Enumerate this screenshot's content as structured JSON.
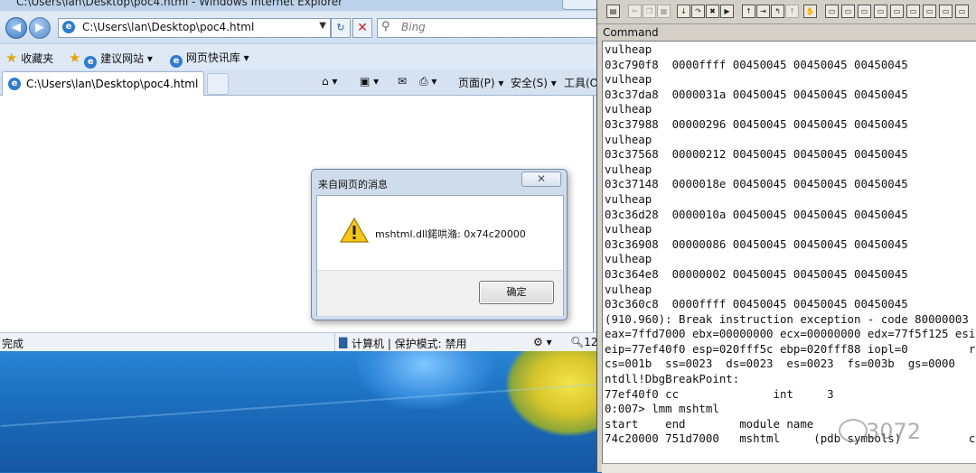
{
  "ie": {
    "title": "C:\\Users\\lan\\Desktop\\poc4.html - Windows Internet Explorer",
    "address": "C:\\Users\\lan\\Desktop\\poc4.html",
    "search_placeholder": "Bing",
    "favorites_label": "收藏夹",
    "fav_items": [
      "建议网站 ▾",
      "网页快讯库 ▾"
    ],
    "tab_title": "C:\\Users\\lan\\Desktop\\poc4.html",
    "commands": [
      "页面(P) ▾",
      "安全(S) ▾",
      "工具(O)"
    ],
    "status_left": "完成",
    "status_zone": "计算机 | 保护模式: 禁用",
    "zoom": "12"
  },
  "dialog": {
    "title": "来自网页的消息",
    "message": "mshtml.dll鍩哄潃: 0x74c20000",
    "ok_label": "确定",
    "close_glyph": "✕"
  },
  "windbg": {
    "panel_title": "Command",
    "lines": [
      "vulheap",
      "03c790f8  0000ffff 00450045 00450045 00450045",
      "vulheap",
      "03c37da8  0000031a 00450045 00450045 00450045",
      "vulheap",
      "03c37988  00000296 00450045 00450045 00450045",
      "vulheap",
      "03c37568  00000212 00450045 00450045 00450045",
      "vulheap",
      "03c37148  0000018e 00450045 00450045 00450045",
      "vulheap",
      "03c36d28  0000010a 00450045 00450045 00450045",
      "vulheap",
      "03c36908  00000086 00450045 00450045 00450045",
      "vulheap",
      "03c364e8  00000002 00450045 00450045 00450045",
      "vulheap",
      "03c360c8  0000ffff 00450045 00450045 00450045",
      "(910.960): Break instruction exception - code 80000003",
      "eax=7ffd7000 ebx=00000000 ecx=00000000 edx=77f5f125 esi",
      "eip=77ef40f0 esp=020fff5c ebp=020fff88 iopl=0         r",
      "cs=001b  ss=0023  ds=0023  es=0023  fs=003b  gs=0000",
      "ntdll!DbgBreakPoint:",
      "77ef40f0 cc              int     3",
      "0:007> lmm mshtml",
      "start    end        module name",
      "74c20000 751d7000   mshtml     (pdb symbols)          c"
    ]
  },
  "watermark": "3072"
}
